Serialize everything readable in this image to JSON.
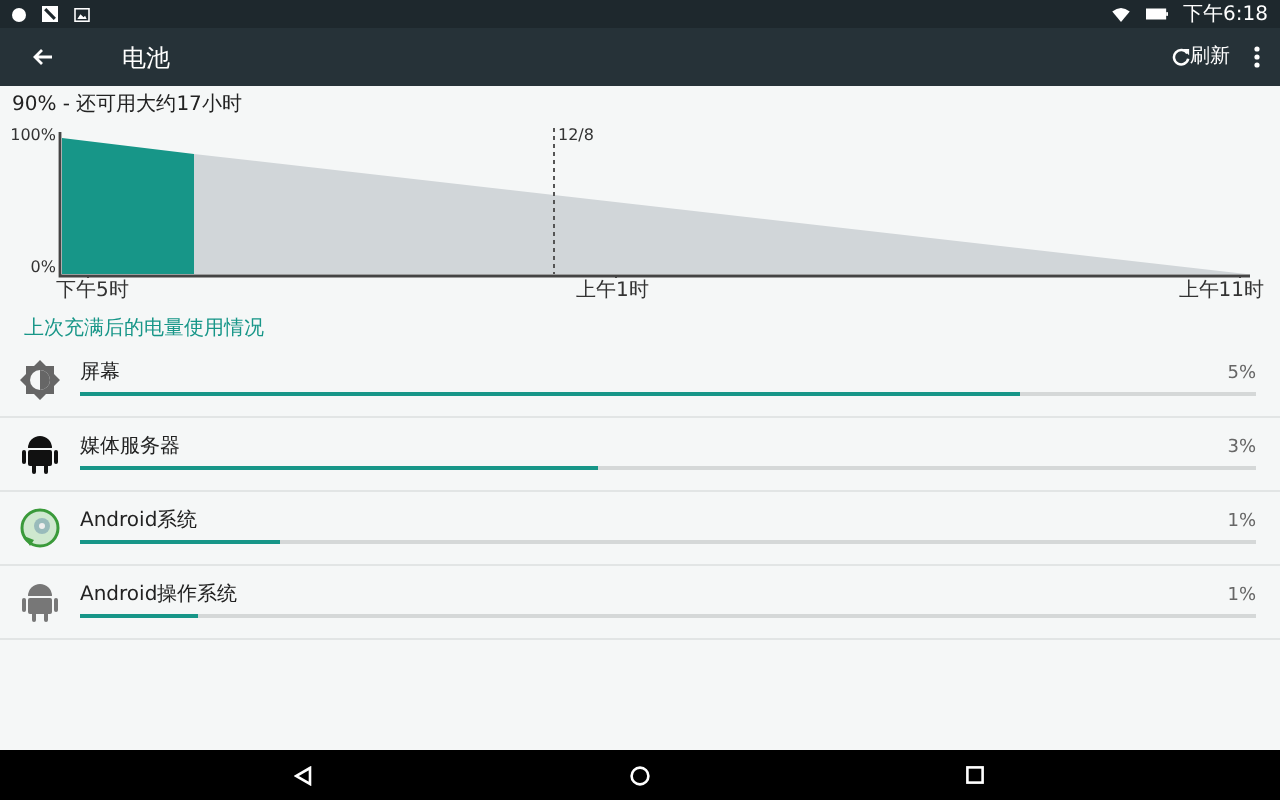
{
  "status_bar": {
    "time": "下午6:18"
  },
  "toolbar": {
    "title": "电池",
    "action": "刷新"
  },
  "summary": "90% - 还可用大约17小时",
  "chart": {
    "y_labels": [
      "100%",
      "0%"
    ],
    "marker_label": "12/8",
    "x_labels": [
      "下午5时",
      "上午1时",
      "上午11时"
    ]
  },
  "section_title": "上次充满后的电量使用情况",
  "items": [
    {
      "name": "屏幕",
      "percent": "5%",
      "level": 0.8,
      "kind": "brightness"
    },
    {
      "name": "媒体服务器",
      "percent": "3%",
      "level": 0.44,
      "kind": "android-dark"
    },
    {
      "name": "Android系统",
      "percent": "1%",
      "level": 0.17,
      "kind": "disc"
    },
    {
      "name": "Android操作系统",
      "percent": "1%",
      "level": 0.1,
      "kind": "android-grey"
    }
  ]
}
